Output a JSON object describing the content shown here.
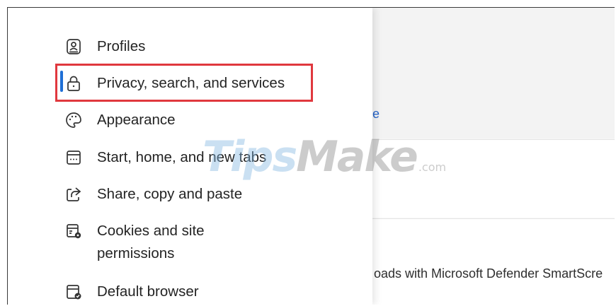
{
  "sidebar": {
    "items": [
      {
        "label": "Profiles",
        "icon": "profiles-icon"
      },
      {
        "label": "Privacy, search, and services",
        "icon": "lock-icon",
        "selected": true
      },
      {
        "label": "Appearance",
        "icon": "palette-icon"
      },
      {
        "label": "Start, home, and new tabs",
        "icon": "start-home-icon"
      },
      {
        "label": "Share, copy and paste",
        "icon": "share-icon"
      },
      {
        "label": "Cookies and site permissions",
        "icon": "cookies-permissions-icon"
      },
      {
        "label": "Default browser",
        "icon": "default-browser-icon"
      }
    ]
  },
  "content": {
    "partial_link": "e",
    "defender_text": "oads with Microsoft Defender SmartScre"
  },
  "watermark": {
    "tips": "Tips",
    "make": "Make",
    "com": ".com"
  },
  "colors": {
    "accent": "#1f6fd6",
    "highlight_border": "#e0383e",
    "text": "#242424"
  }
}
